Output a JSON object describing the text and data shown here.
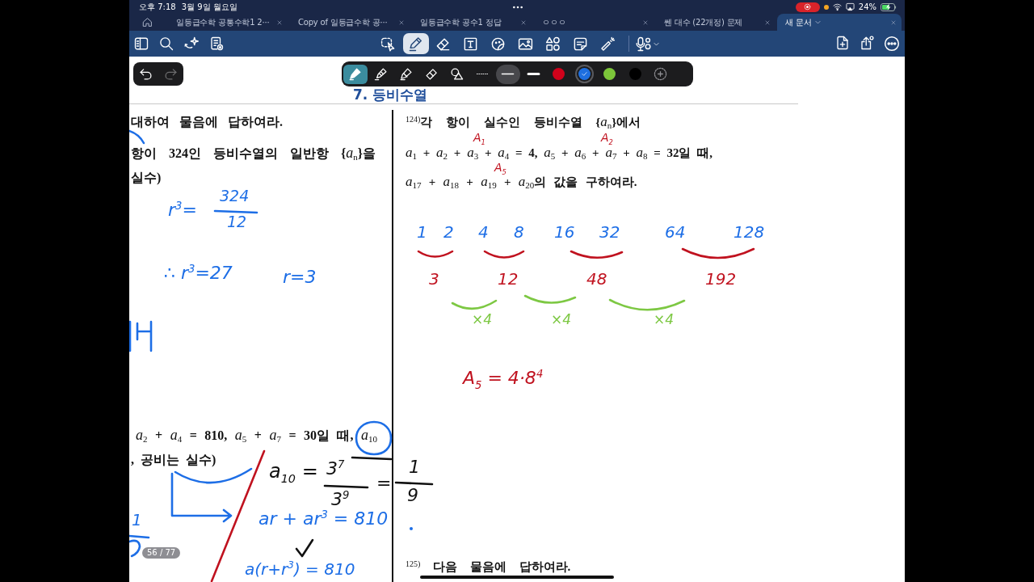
{
  "status_bar": {
    "time": "오후 7:18",
    "date": "3월 9일 월요일",
    "battery": "24%"
  },
  "tabs": [
    {
      "label": "일등급수학 공통수학1 2···",
      "selected": false
    },
    {
      "label": "Copy of 일등급수학 공···",
      "selected": false
    },
    {
      "label": "일등급수학 공수1 정답",
      "selected": false
    },
    {
      "label": "ㅇㅇㅇ",
      "selected": false
    },
    {
      "label": "쎈 대수 (22개정) 문제",
      "selected": false
    },
    {
      "label": "새 문서",
      "selected": true
    }
  ],
  "toolbar": {
    "tools": [
      {
        "selected": false
      },
      {
        "selected": true
      },
      {
        "selected": false
      },
      {
        "selected": false
      },
      {
        "selected": false
      },
      {
        "selected": false
      },
      {
        "selected": false
      },
      {
        "selected": false
      },
      {
        "selected": false
      }
    ]
  },
  "pen_palette": {
    "undo": {
      "disabled": false
    },
    "redo": {
      "disabled": true
    },
    "tools": [
      {
        "selected": true
      },
      {
        "selected": false
      },
      {
        "selected": false
      },
      {
        "selected": false
      },
      {
        "selected": false
      }
    ],
    "widths": [
      {
        "selected": false
      },
      {
        "selected": true
      },
      {
        "selected": false
      }
    ],
    "colors": [
      {
        "color": "#d0021b",
        "selected": false
      },
      {
        "color": "#1e6fe0",
        "selected": true
      },
      {
        "color": "#7cc63a",
        "selected": false
      },
      {
        "color": "#000000",
        "selected": false
      }
    ]
  },
  "page": {
    "heading": "7. 등비수열",
    "left_column": [
      "대하여 물음에 답하여라.",
      "항이 324인 등비수열의 일반항 {*a*$_{n}$}을",
      "실수)",
      "*a*$_{2}$ + *a*$_{4}$ = 810, *a*$_{5}$ + *a*$_{7}$ = 30일 때, *a*$_{10}$",
      ", 공비는 실수)"
    ],
    "right_column": [
      "$^{124)}$각 항이 실수인 등비수열 {*a*$_{n}$}에서",
      "*a*$_{1}$ + *a*$_{2}$ + *a*$_{3}$ + *a*$_{4}$ = 4, *a*$_{5}$ + *a*$_{6}$ + *a*$_{7}$ + *a*$_{8}$ = 32일 때,",
      "*a*$_{17}$ + *a*$_{18}$ + *a*$_{19}$ + *a*$_{20}$의 값을 구하여라."
    ],
    "next_problem": "$^{125)}$ 다음 물음에 답하여라."
  },
  "ink_texts": [
    {
      "text": "r$^{3}$=",
      "color": "#1d6ee6"
    },
    {
      "text": "324",
      "color": "#1d6ee6"
    },
    {
      "text": "12",
      "color": "#1d6ee6"
    },
    {
      "text": "∴ r$^{3}$=27",
      "color": "#1d6ee6"
    },
    {
      "text": "r=3",
      "color": "#1d6ee6"
    },
    {
      "text": "a$_{10}$ =",
      "color": "#111111"
    },
    {
      "text": "3$^{7}$",
      "color": "#111111"
    },
    {
      "text": "3$^{9}$",
      "color": "#111111"
    },
    {
      "text": "=",
      "color": "#111111"
    },
    {
      "text": "1",
      "color": "#111111"
    },
    {
      "text": "9",
      "color": "#111111"
    },
    {
      "text": "ar + ar$^{3}$ = 810",
      "color": "#1d6ee6"
    },
    {
      "text": "a(r+r$^{3}$) = 810",
      "color": "#1d6ee6"
    },
    {
      "text": "1",
      "color": "#1d6ee6"
    },
    {
      "text": "A$_{1}$",
      "color": "#c0121f"
    },
    {
      "text": "A$_{2}$",
      "color": "#c0121f"
    },
    {
      "text": "A$_{5}$",
      "color": "#c0121f"
    },
    {
      "text": "1",
      "color": "#1d6ee6"
    },
    {
      "text": "2",
      "color": "#1d6ee6"
    },
    {
      "text": "4",
      "color": "#1d6ee6"
    },
    {
      "text": "8",
      "color": "#1d6ee6"
    },
    {
      "text": "16",
      "color": "#1d6ee6"
    },
    {
      "text": "32",
      "color": "#1d6ee6"
    },
    {
      "text": "64",
      "color": "#1d6ee6"
    },
    {
      "text": "128",
      "color": "#1d6ee6"
    },
    {
      "text": "3",
      "color": "#c0121f"
    },
    {
      "text": "12",
      "color": "#c0121f"
    },
    {
      "text": "48",
      "color": "#c0121f"
    },
    {
      "text": "192",
      "color": "#c0121f"
    },
    {
      "text": "×4",
      "color": "#7dc843"
    },
    {
      "text": "×4",
      "color": "#7dc843"
    },
    {
      "text": "×4",
      "color": "#7dc843"
    },
    {
      "text": "A$_{5}$ = 4·8$^{4}$",
      "color": "#c0121f"
    }
  ],
  "ink_strokes": [
    {
      "kind": "curve",
      "color": "#1d6ee6"
    },
    {
      "kind": "scribble",
      "color": "#1d6ee6"
    },
    {
      "kind": "line",
      "color": "#1d6ee6"
    },
    {
      "kind": "circle",
      "color": "#1d6ee6"
    },
    {
      "kind": "line",
      "color": "#111111"
    },
    {
      "kind": "curve",
      "color": "#1d6ee6"
    },
    {
      "kind": "arrow",
      "color": "#1d6ee6"
    },
    {
      "kind": "line",
      "color": "#c0121f"
    },
    {
      "kind": "line",
      "color": "#111111"
    },
    {
      "kind": "line",
      "color": "#111111"
    },
    {
      "kind": "check",
      "color": "#111111"
    },
    {
      "kind": "line",
      "color": "#1d6ee6"
    },
    {
      "kind": "scribble",
      "color": "#1d6ee6"
    },
    {
      "kind": "dot",
      "color": "#1d6ee6"
    },
    {
      "kind": "arc",
      "color": "#c0121f"
    },
    {
      "kind": "arc",
      "color": "#c0121f"
    },
    {
      "kind": "arc",
      "color": "#c0121f"
    },
    {
      "kind": "arc",
      "color": "#c0121f"
    },
    {
      "kind": "arc",
      "color": "#7dc843"
    },
    {
      "kind": "arc",
      "color": "#7dc843"
    },
    {
      "kind": "arc",
      "color": "#7dc843"
    }
  ],
  "page_indicator": "56 / 77"
}
